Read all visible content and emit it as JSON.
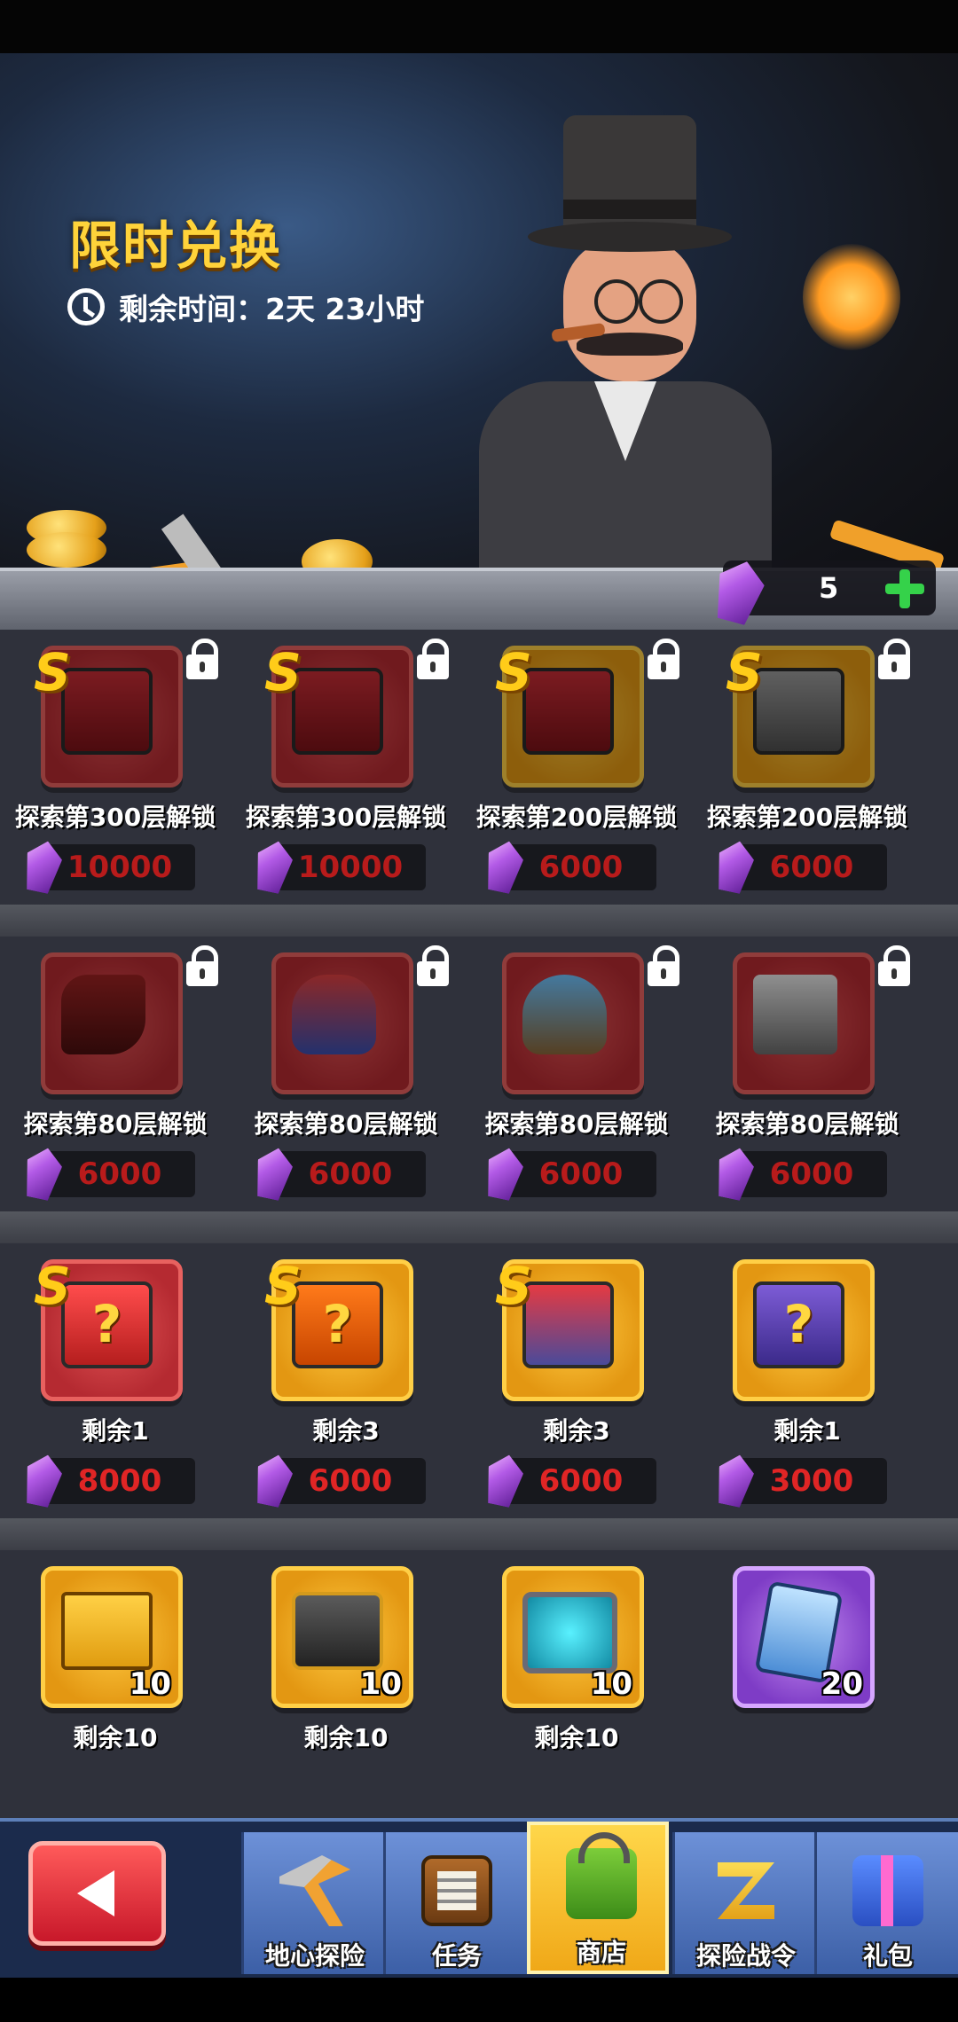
{
  "header": {
    "title": "限时兑换",
    "timer_text": "剩余时间：2天 23小时"
  },
  "currency": {
    "gems": "5"
  },
  "rows": [
    {
      "items": [
        {
          "label": "探索第300层解锁",
          "price": "10000",
          "srank": "S",
          "locked": true
        },
        {
          "label": "探索第300层解锁",
          "price": "10000",
          "srank": "S",
          "locked": true
        },
        {
          "label": "探索第200层解锁",
          "price": "6000",
          "srank": "S",
          "locked": true
        },
        {
          "label": "探索第200层解锁",
          "price": "6000",
          "srank": "S",
          "locked": true
        }
      ]
    },
    {
      "items": [
        {
          "label": "探索第80层解锁",
          "price": "6000",
          "locked": true
        },
        {
          "label": "探索第80层解锁",
          "price": "6000",
          "locked": true
        },
        {
          "label": "探索第80层解锁",
          "price": "6000",
          "locked": true
        },
        {
          "label": "探索第80层解锁",
          "price": "6000",
          "locked": true
        }
      ]
    },
    {
      "items": [
        {
          "label": "剩余1",
          "price": "8000",
          "srank": "S"
        },
        {
          "label": "剩余3",
          "price": "6000",
          "srank": "S"
        },
        {
          "label": "剩余3",
          "price": "6000",
          "srank": "S"
        },
        {
          "label": "剩余1",
          "price": "3000"
        }
      ]
    },
    {
      "items": [
        {
          "label": "剩余10",
          "count": "10"
        },
        {
          "label": "剩余10",
          "count": "10"
        },
        {
          "label": "剩余10",
          "count": "10"
        },
        {
          "count": "20"
        }
      ]
    }
  ],
  "nav": {
    "tabs": [
      {
        "label": "地心探险"
      },
      {
        "label": "任务"
      },
      {
        "label": "商店"
      },
      {
        "label": "探险战令"
      },
      {
        "label": "礼包"
      }
    ],
    "active_tab": "商店"
  },
  "colors": {
    "title": "#ffd33a",
    "price_text": "#e02525",
    "gem_plus": "#35d24a",
    "nav_active": "#ffd74a"
  },
  "icons": [
    "clock-icon",
    "gem-icon",
    "plus-icon",
    "lock-icon",
    "back-arrow-icon",
    "pickaxe-icon",
    "task-icon",
    "shop-basket-icon",
    "battle-pass-icon",
    "gift-icon"
  ]
}
